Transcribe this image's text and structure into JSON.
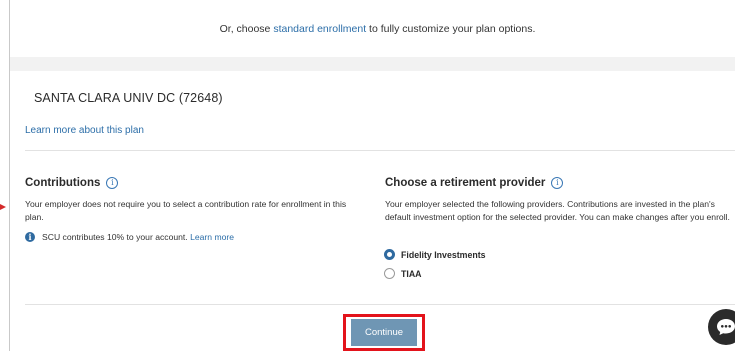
{
  "top_band": {
    "prefix": "Or, choose ",
    "link": "standard enrollment",
    "suffix": " to fully customize your plan options."
  },
  "plan": {
    "name": "SANTA CLARA UNIV DC (72648)",
    "learn_more": "Learn more about this plan"
  },
  "contributions": {
    "title": "Contributions",
    "info_glyph": "i",
    "text": "Your employer does not require you to select a contribution rate for enrollment in this plan.",
    "note": "SCU contributes 10% to your account.",
    "note_link": "Learn more"
  },
  "provider": {
    "title": "Choose a retirement provider",
    "info_glyph": "i",
    "text": "Your employer selected the following providers. Contributions are invested in the plan's default investment option for the selected provider. You can make changes after you enroll.",
    "options": [
      {
        "label": "Fidelity Investments",
        "selected": true
      },
      {
        "label": "TIAA",
        "selected": false
      }
    ]
  },
  "actions": {
    "continue_label": "Continue"
  },
  "colors": {
    "link": "#2c6ea8",
    "accent": "#2f6aa0",
    "button": "#6f96b4",
    "highlight": "#e3131b"
  },
  "icons": {
    "info": "info-circle-icon",
    "chat": "chat-bubble-icon"
  }
}
